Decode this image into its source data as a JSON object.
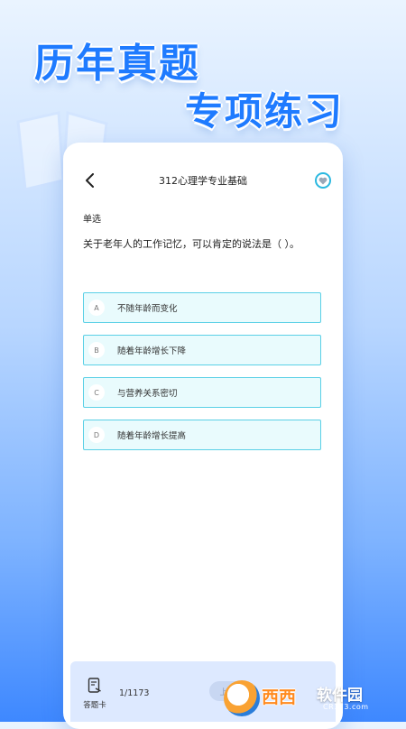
{
  "promo": {
    "line1": "历年真题",
    "line2": "专项练习"
  },
  "header": {
    "title": "312心理学专业基础",
    "back_icon": "chevron-left-icon",
    "favorite_icon": "heart-icon"
  },
  "question": {
    "type": "单选",
    "text": "关于老年人的工作记忆，可以肯定的说法是（ ）。",
    "options": [
      {
        "letter": "A",
        "text": "不随年龄而变化"
      },
      {
        "letter": "B",
        "text": "随着年龄增长下降"
      },
      {
        "letter": "C",
        "text": "与营养关系密切"
      },
      {
        "letter": "D",
        "text": "随着年龄增长提高"
      }
    ]
  },
  "bottom_bar": {
    "answer_card_label": "答题卡",
    "progress": "1/1173",
    "prev_label": "上一题"
  },
  "watermark": {
    "brand": "西西",
    "suffix": "软件园",
    "url": "CR173.com"
  },
  "colors": {
    "accent": "#1f7bff",
    "option_border": "#5ad0e6",
    "option_bg": "#e9fbfd",
    "favorite": "#2bb8e0"
  }
}
